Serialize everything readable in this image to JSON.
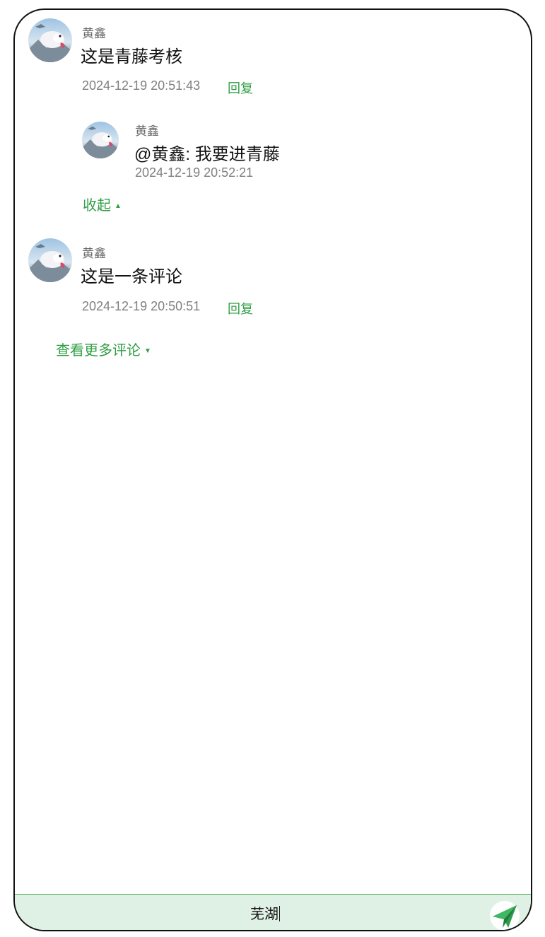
{
  "comments": [
    {
      "username": "黄鑫",
      "content": "这是青藤考核",
      "time": "2024-12-19 20:51:43",
      "reply_label": "回复",
      "replies": [
        {
          "username": "黄鑫",
          "content": "@黄鑫: 我要进青藤",
          "time": "2024-12-19 20:52:21"
        }
      ],
      "collapse_label": "收起"
    },
    {
      "username": "黄鑫",
      "content": "这是一条评论",
      "time": "2024-12-19 20:50:51",
      "reply_label": "回复"
    }
  ],
  "more_comments_label": "查看更多评论",
  "input": {
    "value": "芜湖"
  },
  "icons": {
    "avatar": "avatar-image",
    "send": "paper-plane-icon",
    "collapse": "triangle-up-icon",
    "expand": "triangle-down-icon"
  },
  "colors": {
    "accent": "#2f9e44",
    "input_bg": "#dff0e5"
  }
}
